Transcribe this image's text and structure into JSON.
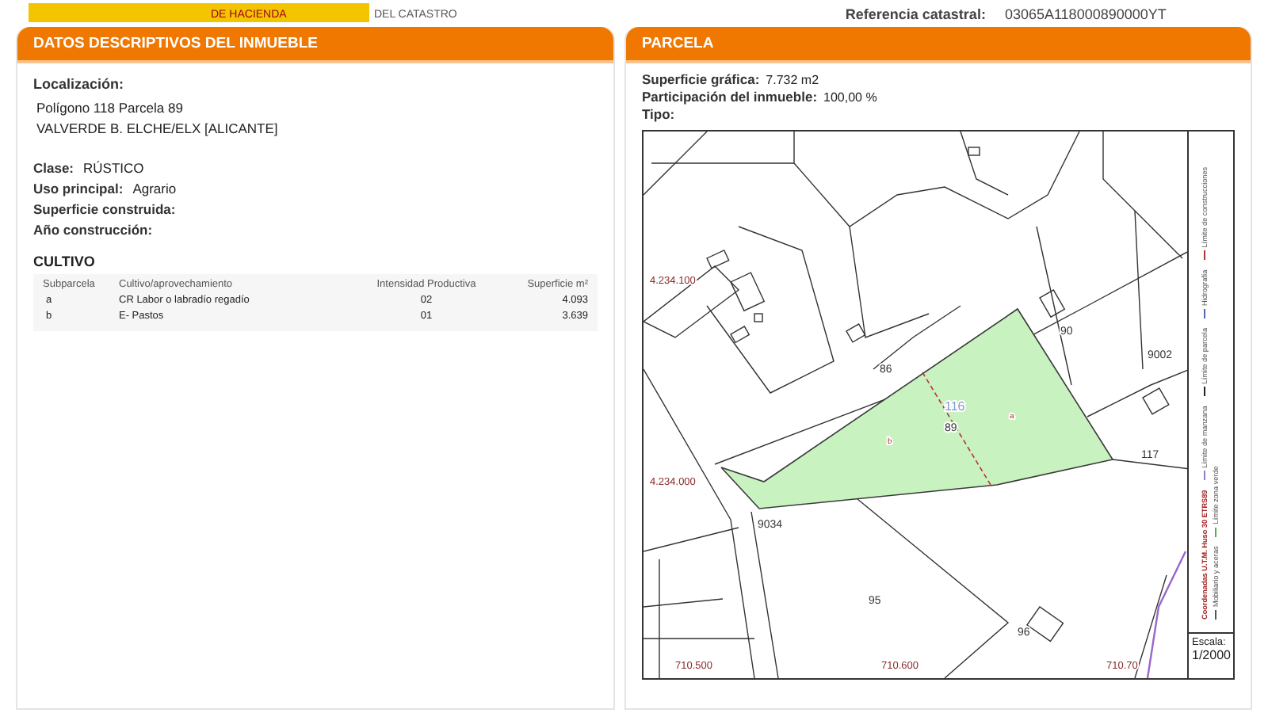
{
  "header": {
    "ministry": "DE HACIENDA",
    "office": "DEL CATASTRO",
    "reference_label": "Referencia catastral:",
    "reference_value": "03065A118000890000YT"
  },
  "inmueble": {
    "title": "DATOS DESCRIPTIVOS DEL INMUEBLE",
    "location_label": "Localización:",
    "location_lines": [
      "Polígono 118 Parcela 89",
      "VALVERDE B. ELCHE/ELX [ALICANTE]"
    ],
    "fields": [
      {
        "label": "Clase:",
        "value": "RÚSTICO"
      },
      {
        "label": "Uso principal:",
        "value": "Agrario"
      },
      {
        "label": "Superficie construida:"
      },
      {
        "label": "Año construcción:"
      }
    ],
    "cultivo": {
      "title": "CULTIVO",
      "columns": [
        "Subparcela",
        "Cultivo/aprovechamiento",
        "Intensidad Productiva",
        "Superficie m²"
      ],
      "rows": [
        [
          "a",
          "CR Labor o labradío regadío",
          "02",
          "4.093"
        ],
        [
          "b",
          "E- Pastos",
          "01",
          "3.639"
        ]
      ]
    }
  },
  "parcela": {
    "title": "PARCELA",
    "fields": [
      {
        "label": "Superficie gráfica:",
        "value": "7.732 m2"
      },
      {
        "label": "Participación del inmueble:",
        "value": "100,00 %"
      },
      {
        "label": "Tipo:"
      }
    ],
    "map": {
      "labels": [
        {
          "text": "86",
          "kind": "parcel"
        },
        {
          "text": "116",
          "kind": "block"
        },
        {
          "text": "89",
          "kind": "parcel"
        },
        {
          "text": "90",
          "kind": "parcel"
        },
        {
          "text": "9002",
          "kind": "parcel"
        },
        {
          "text": "117",
          "kind": "parcel"
        },
        {
          "text": "9034",
          "kind": "parcel"
        },
        {
          "text": "95",
          "kind": "parcel"
        },
        {
          "text": "96",
          "kind": "parcel"
        },
        {
          "text": "a",
          "kind": "sub"
        },
        {
          "text": "b",
          "kind": "sub"
        },
        {
          "text": "4.234.100",
          "kind": "coord"
        },
        {
          "text": "4.234.000",
          "kind": "coord"
        },
        {
          "text": "710.500",
          "kind": "coord"
        },
        {
          "text": "710.600",
          "kind": "coord"
        },
        {
          "text": "710.70",
          "kind": "coord"
        }
      ],
      "legend": [
        "Límite de manzana",
        "Límite de parcela",
        "Hidrografía",
        "Límite de construcciones",
        "Mobiliario y aceras",
        "Límite zona verde"
      ],
      "coordinates_note": "Coordenadas U.T.M. Huso 30 ETRS89",
      "scale_label": "Escala:",
      "scale_value": "1/2000"
    }
  }
}
